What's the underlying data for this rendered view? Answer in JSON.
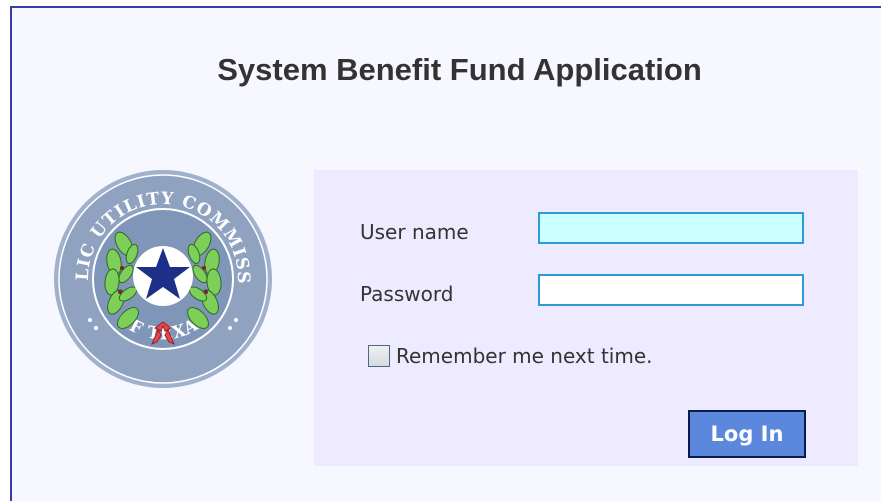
{
  "page": {
    "title": "System Benefit Fund Application"
  },
  "seal": {
    "top_text": "PUBLIC UTILITY COMMISSION",
    "bottom_text": "OF TEXAS",
    "colors": {
      "outer_ring": "#8fa3c1",
      "inner_field": "#7f96b8",
      "wreath": "#7dcf59",
      "star": "#1d2f87",
      "ribbon": "#e8474d"
    }
  },
  "login": {
    "username_label": "User name",
    "username_value": "",
    "password_label": "Password",
    "password_value": "",
    "remember_label": "Remember me next time.",
    "remember_checked": false,
    "submit_label": "Log In"
  }
}
